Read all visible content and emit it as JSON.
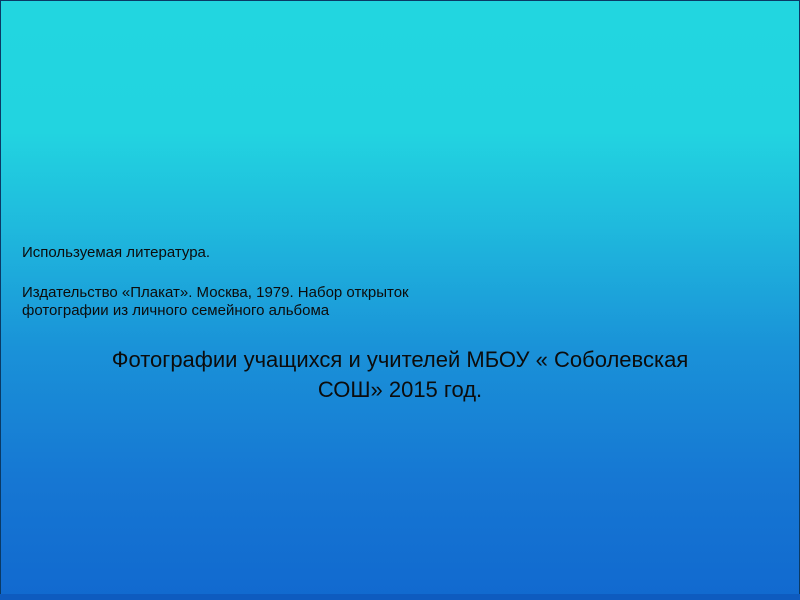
{
  "slide": {
    "references": {
      "heading": "Используемая литература.",
      "line1": "Издательство «Плакат». Москва, 1979. Набор открыток",
      "line2": "фотографии из личного семейного альбома"
    },
    "caption": {
      "line1": "Фотографии учащихся и учителей МБОУ « Соболевская",
      "line2": "СОШ» 2015 год."
    }
  }
}
